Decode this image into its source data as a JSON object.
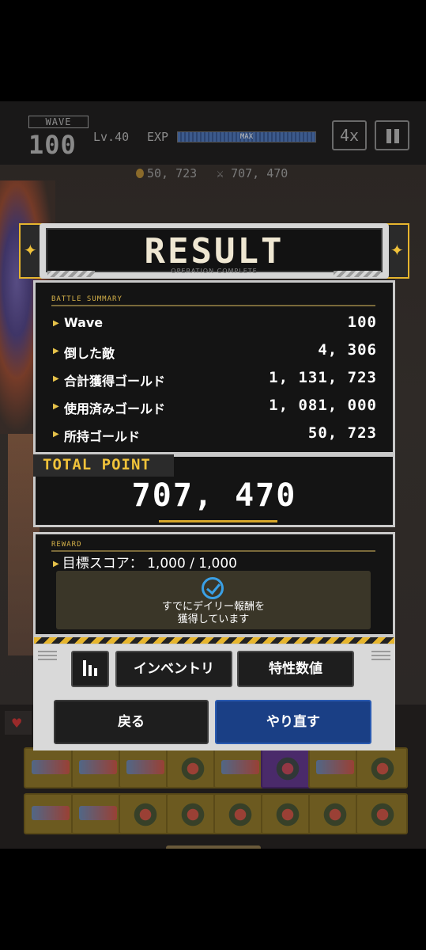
{
  "hud": {
    "wave_label": "WAVE",
    "wave_number": "100",
    "level": "Lv.40",
    "exp_label": "EXP",
    "exp_max": "MAX",
    "exp_fill": 1.0,
    "speed": "4x",
    "gold": "50, 723",
    "attack": "707, 470"
  },
  "result": {
    "title": "RESULT",
    "subtitle": "OPERATION COMPLETE",
    "summary_label": "BATTLE SUMMARY",
    "stats": [
      {
        "label": "Wave",
        "value": "100"
      },
      {
        "label": "倒した敵",
        "value": "4, 306"
      },
      {
        "label": "合計獲得ゴールド",
        "value": "1, 131, 723"
      },
      {
        "label": "使用済みゴールド",
        "value": "1, 081, 000"
      },
      {
        "label": "所持ゴールド",
        "value": "50, 723"
      }
    ],
    "total_label": "TOTAL POINT",
    "total_value": "707, 470",
    "reward_label": "REWARD",
    "reward_score": "目標スコア： 1,000 / 1,000",
    "reward_msg_line1": "すでにデイリー報酬を",
    "reward_msg_line2": "獲得しています"
  },
  "buttons": {
    "inventory": "インベントリ",
    "traits": "特性数値",
    "back": "戻る",
    "retry": "やり直す"
  },
  "colors": {
    "accent_gold": "#f0c23a",
    "retry_blue": "#1a3f85",
    "check_blue": "#3aa0e6"
  }
}
